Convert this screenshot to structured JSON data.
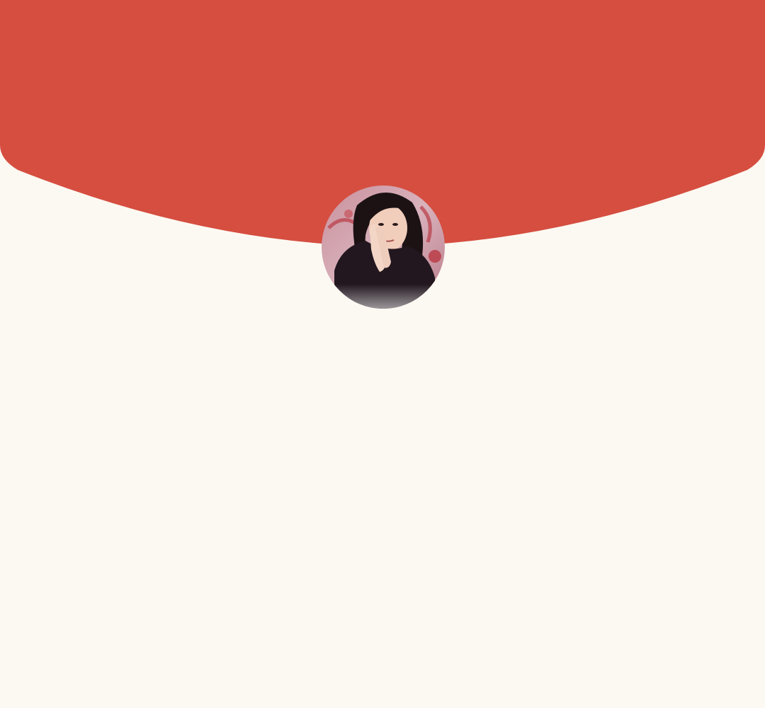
{
  "theme": {
    "header_color": "#d54e40",
    "background_color": "#fcf9f2"
  },
  "profile": {
    "avatar_icon": "user-photo-avatar"
  }
}
